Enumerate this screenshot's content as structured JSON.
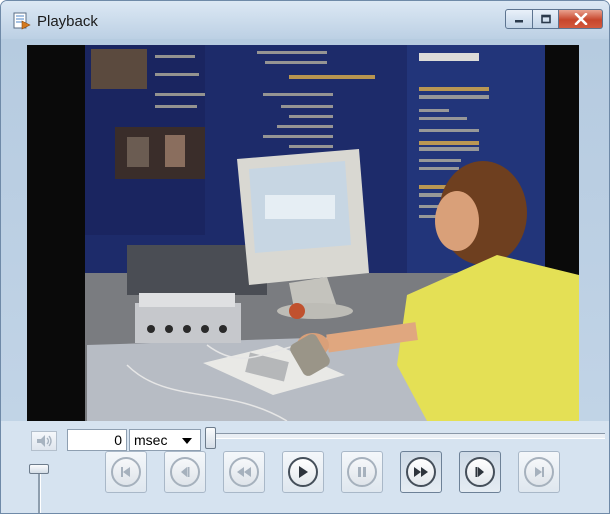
{
  "window": {
    "title": "Playback"
  },
  "icons": {
    "app": "playback-app-icon",
    "minimize": "minimize-icon",
    "maximize": "maximize-icon",
    "close": "close-icon",
    "mute": "speaker-icon",
    "dropdown": "chevron-down-icon",
    "first": "skip-to-start-icon",
    "step_back": "step-back-icon",
    "rewind": "rewind-icon",
    "play": "play-icon",
    "pause": "pause-icon",
    "fast_forward": "fast-forward-icon",
    "step_forward": "step-forward-icon",
    "last": "skip-to-end-icon"
  },
  "controls": {
    "time_value": "0",
    "time_unit": "msec",
    "seek_position": 0,
    "volume_level": 1.0
  },
  "transport": {
    "pressed_buttons": [
      "fast_forward",
      "step_forward"
    ]
  },
  "colors": {
    "close_button": "#c7462c",
    "video_background": "#000000"
  }
}
